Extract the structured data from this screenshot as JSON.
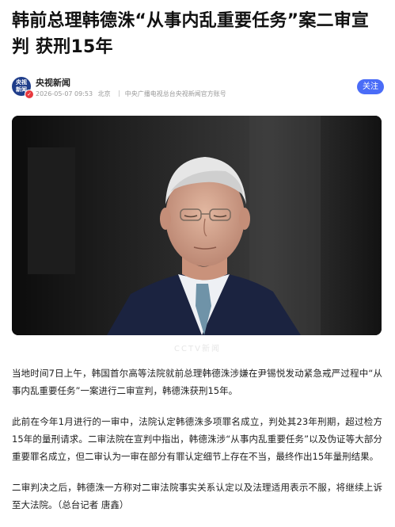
{
  "article": {
    "title": "韩前总理韩德洙“从事内乱重要任务”案二审宣判 获刑15年",
    "watermark": "CCTV新闻"
  },
  "author": {
    "avatar_text": "央视新闻",
    "name": "央视新闻",
    "date": "2026-05-07 09:53",
    "location": "北京",
    "description": "中央广播电视总台央视新闻官方账号",
    "follow_label": "关注"
  },
  "paragraphs": [
    "当地时间7日上午，韩国首尔高等法院就前总理韩德洙涉嫌在尹锡悦发动紧急戒严过程中“从事内乱重要任务”一案进行二审宣判，韩德洙获刑15年。",
    "此前在今年1月进行的一审中，法院认定韩德洙多项罪名成立，判处其23年刑期，超过检方15年的量刑请求。二审法院在宣判中指出，韩德洙涉“从事内乱重要任务”以及伪证等大部分重要罪名成立，但二审认为一审在部分有罪认定细节上存在不当，最终作出15年量刑结果。",
    "二审判决之后，韩德洙一方称对二审法院事实关系认定以及法理适用表示不服，将继续上诉至大法院。（总台记者 唐鑫）"
  ],
  "colors": {
    "follow_button": "#4a6cf7",
    "meta_text": "#999999",
    "verified_badge": "#e8383d"
  }
}
